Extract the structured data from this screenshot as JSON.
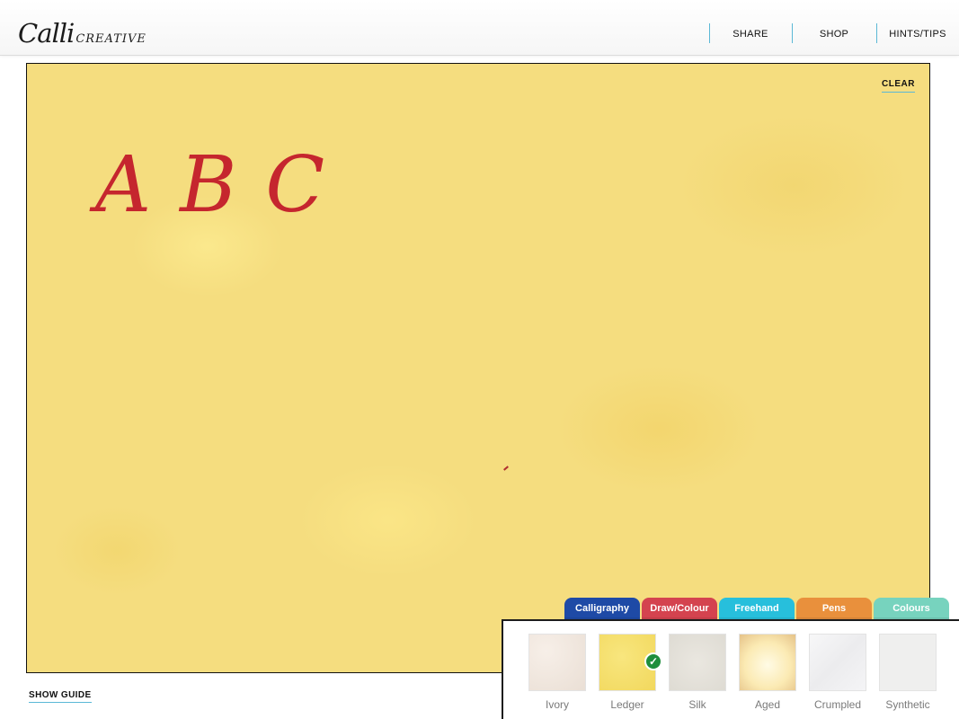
{
  "header": {
    "logo_primary": "Calli",
    "logo_secondary": "CREATIVE",
    "nav": [
      {
        "label": "SHARE"
      },
      {
        "label": "SHOP"
      },
      {
        "label": "HINTS/TIPS"
      }
    ]
  },
  "canvas": {
    "clear_label": "CLEAR",
    "letters": [
      "A",
      "B",
      "C"
    ],
    "ink_color": "#c5262e",
    "paper_color": "#f5dd7f"
  },
  "guide": {
    "show_label": "SHOW GUIDE"
  },
  "tabs": [
    {
      "label": "Calligraphy",
      "color": "#1e4aa6"
    },
    {
      "label": "Draw/Colour",
      "color": "#d4434f"
    },
    {
      "label": "Freehand",
      "color": "#27bfdc"
    },
    {
      "label": "Pens",
      "color": "#e9903c"
    },
    {
      "label": "Colours",
      "color": "#77d3be"
    }
  ],
  "papers": {
    "selected": "Ledger",
    "items": [
      {
        "label": "Ivory",
        "icon": "ivory-paper-swatch"
      },
      {
        "label": "Ledger",
        "icon": "ledger-paper-swatch"
      },
      {
        "label": "Silk",
        "icon": "silk-paper-swatch"
      },
      {
        "label": "Aged",
        "icon": "aged-paper-swatch"
      },
      {
        "label": "Crumpled",
        "icon": "crumpled-paper-swatch"
      },
      {
        "label": "Synthetic",
        "icon": "synthetic-paper-swatch"
      }
    ]
  }
}
